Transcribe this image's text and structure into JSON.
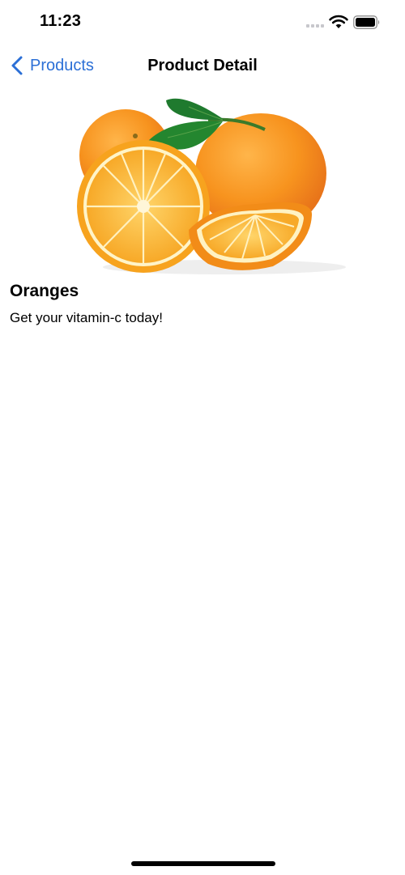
{
  "status_bar": {
    "time": "11:23"
  },
  "nav": {
    "back_label": "Products",
    "title": "Product Detail"
  },
  "product": {
    "name": "Oranges",
    "description": "Get your vitamin-c today!"
  },
  "colors": {
    "accent": "#2b6fd6",
    "orange": "#f7931e",
    "leaf": "#1f7a2e"
  },
  "icons": [
    "wifi-icon",
    "battery-icon",
    "cellular-signal-icon",
    "chevron-left-icon"
  ]
}
